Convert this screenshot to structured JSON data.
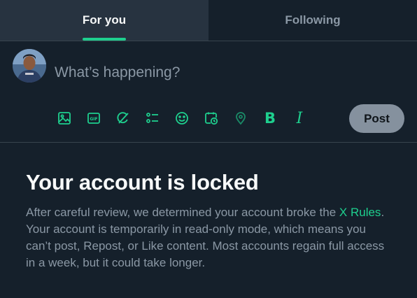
{
  "tabs": [
    {
      "label": "For you",
      "active": true
    },
    {
      "label": "Following",
      "active": false
    }
  ],
  "composer": {
    "placeholder": "What’s happening?",
    "tools": [
      "image-icon",
      "gif-icon",
      "grok-icon",
      "poll-icon",
      "emoji-icon",
      "schedule-icon",
      "location-icon",
      "bold-icon",
      "italic-icon"
    ],
    "bold_glyph": "B",
    "italic_glyph": "I",
    "post_label": "Post"
  },
  "locked": {
    "title": "Your account is locked",
    "body_pre": "After careful review, we determined your account broke the ",
    "rules_link": "X Rules",
    "body_post": ". Your account is temporarily in read-only mode, which means you can’t post, Repost, or Like content. Most accounts regain full access in a week, but it could take longer."
  },
  "colors": {
    "background": "#15202b",
    "accent": "#1ecf8e",
    "muted": "#8b98a5",
    "active_tab": "#273340"
  }
}
